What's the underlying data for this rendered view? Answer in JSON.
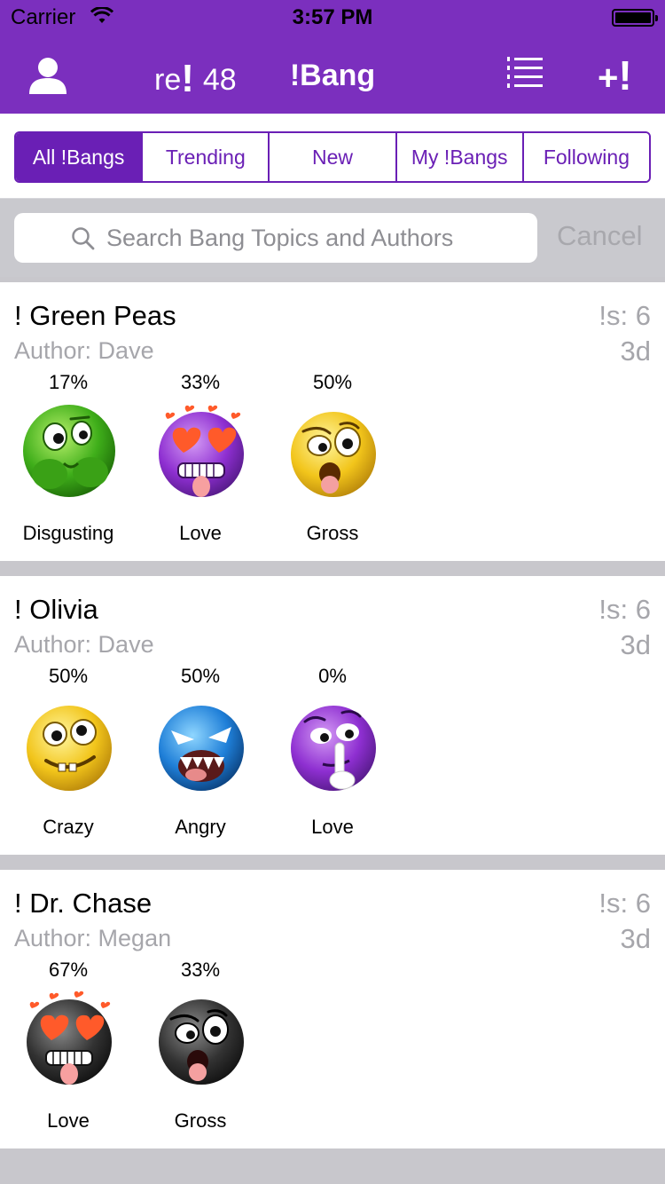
{
  "status_bar": {
    "carrier": "Carrier",
    "time": "3:57 PM"
  },
  "nav": {
    "rebang_prefix": "re",
    "rebang_excl": "!",
    "rebang_count": "48",
    "title": "!Bang",
    "add_plus": "+",
    "add_excl": "!"
  },
  "segments": [
    "All !Bangs",
    "Trending",
    "New",
    "My !Bangs",
    "Following"
  ],
  "active_segment": "All !Bangs",
  "search": {
    "placeholder": "Search Bang Topics and Authors",
    "value": "",
    "cancel_label": "Cancel"
  },
  "colors": {
    "brand": "#7b2fbe",
    "segment": "#6a1fb5",
    "muted": "#a6a6ab"
  },
  "bangs": [
    {
      "topic": "! Green Peas",
      "author": "Author: Dave",
      "count": "!s: 6",
      "age": "3d",
      "reactions": [
        {
          "percent": "17%",
          "label": "Disgusting",
          "icon": "disgusting-emoji-icon"
        },
        {
          "percent": "33%",
          "label": "Love",
          "icon": "love-emoji-icon"
        },
        {
          "percent": "50%",
          "label": "Gross",
          "icon": "gross-emoji-icon"
        }
      ]
    },
    {
      "topic": "! Olivia",
      "author": "Author: Dave",
      "count": "!s: 6",
      "age": "3d",
      "reactions": [
        {
          "percent": "50%",
          "label": "Crazy",
          "icon": "crazy-emoji-icon"
        },
        {
          "percent": "50%",
          "label": "Angry",
          "icon": "angry-emoji-icon"
        },
        {
          "percent": "0%",
          "label": "Love",
          "icon": "shush-emoji-icon"
        }
      ]
    },
    {
      "topic": "! Dr. Chase",
      "author": "Author: Megan",
      "count": "!s: 6",
      "age": "3d",
      "reactions": [
        {
          "percent": "67%",
          "label": "Love",
          "icon": "love-emoji-icon"
        },
        {
          "percent": "33%",
          "label": "Gross",
          "icon": "gross-emoji-icon"
        }
      ]
    }
  ]
}
